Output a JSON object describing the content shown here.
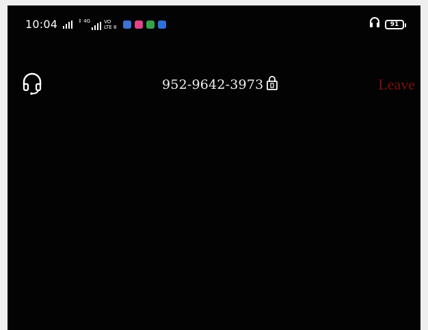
{
  "status_bar": {
    "time": "10:04",
    "network_small": "↕ 4G",
    "volte_top": "VO",
    "volte_bottom": "LTE 8",
    "battery": "91",
    "app_icons": [
      {
        "name": "messaging-app-icon",
        "color": "#3a73d6"
      },
      {
        "name": "instagram-icon",
        "color": "#e2458b"
      },
      {
        "name": "android-app-icon",
        "color": "#36a24a"
      },
      {
        "name": "zoom-icon",
        "color": "#2d71d8"
      }
    ]
  },
  "meeting_header": {
    "meeting_id": "952-9642-3973",
    "leave_label": "Leave",
    "leave_color": "#7a1010"
  },
  "colors": {
    "screen_background": "#030303",
    "text": "#f2f2f2"
  }
}
